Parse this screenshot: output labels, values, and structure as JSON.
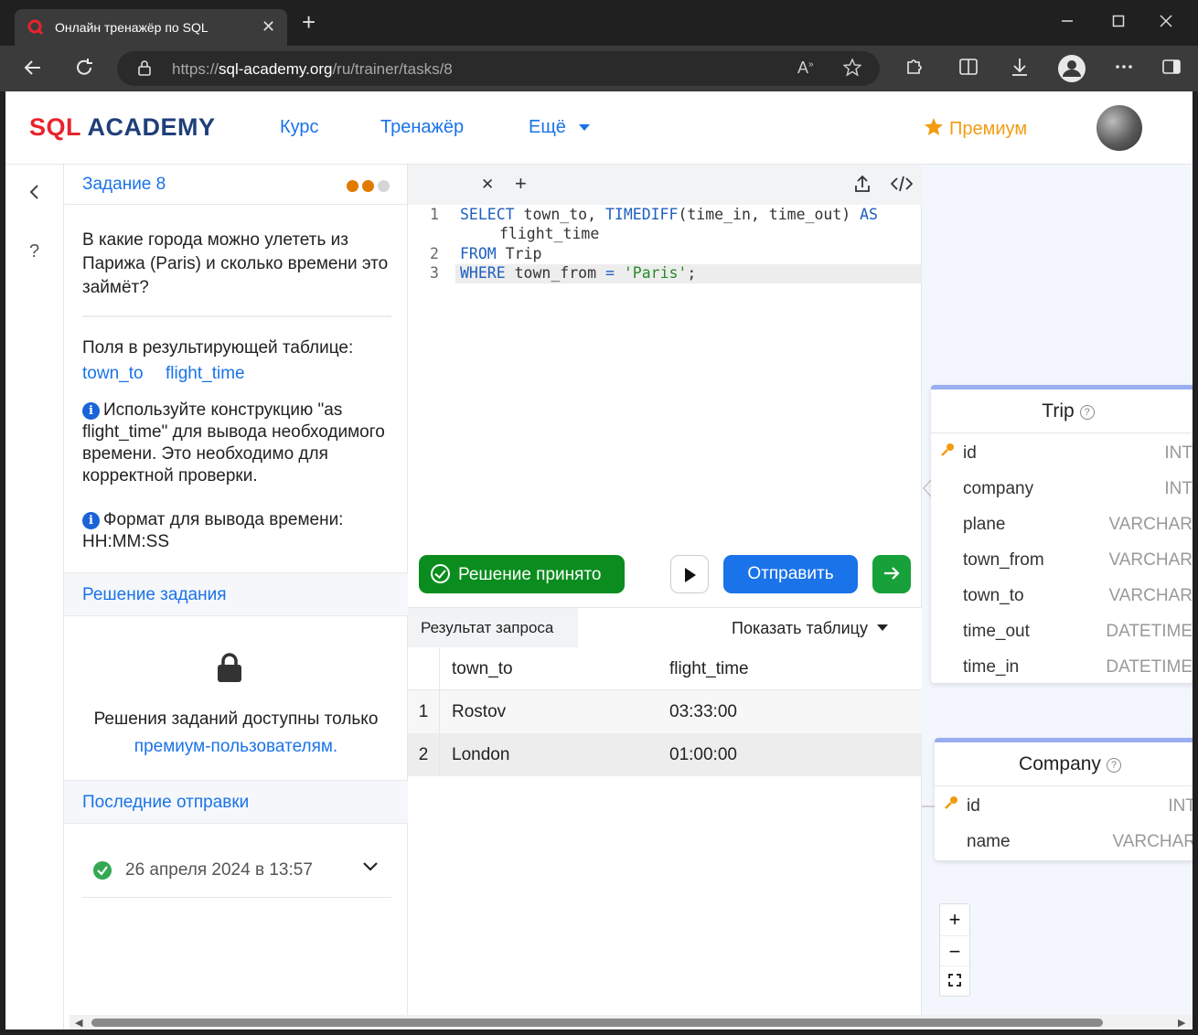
{
  "browser": {
    "tab_title": "Онлайн тренажёр по SQL",
    "tab_close": "✕",
    "new_tab": "+",
    "url_prefix": "https://",
    "url_host": "sql-academy.org",
    "url_path": "/ru/trainer/tasks/8"
  },
  "header": {
    "logo_sql": "SQL",
    "logo_academy": "ACADEMY",
    "nav": [
      "Курс",
      "Тренажёр",
      "Ещё"
    ],
    "premium": "Премиум"
  },
  "rail": {
    "back_icon": "chevron-left-icon",
    "help": "?"
  },
  "task": {
    "title": "Задание 8",
    "dots": [
      "#e07b00",
      "#e07b00",
      "#d0d0d0"
    ],
    "question": "В какие города можно улететь из Парижа (Paris) и сколько времени это займёт?",
    "fields_label": "Поля в результирующей таблице:",
    "fields": [
      "town_to",
      "flight_time"
    ],
    "hint1": "Используйте конструкцию \"as flight_time\" для вывода необходимого времени. Это необходимо для корректной проверки.",
    "hint2": "Формат для вывода времени: HH:MM:SS",
    "solution_header": "Решение задания",
    "locked_text": "Решения заданий доступны только",
    "locked_link": "премиум-пользователям.",
    "submissions_header": "Последние отправки",
    "submission_date": "26 апреля 2024 в 13:57"
  },
  "editor": {
    "lines": [
      {
        "no": "1",
        "code": "SELECT town_to, TIMEDIFF(time_in, time_out) AS"
      },
      {
        "no": "",
        "code": "flight_time"
      },
      {
        "no": "2",
        "code": "FROM Trip"
      },
      {
        "no": "3",
        "code": "WHERE town_from = 'Paris';"
      }
    ],
    "accepted_label": "Решение принято",
    "send_label": "Отправить",
    "result_tab": "Результат запроса",
    "show_table": "Показать таблицу"
  },
  "result": {
    "columns": [
      "town_to",
      "flight_time"
    ],
    "rows": [
      {
        "n": "1",
        "town_to": "Rostov",
        "flight_time": "03:33:00"
      },
      {
        "n": "2",
        "town_to": "London",
        "flight_time": "01:00:00"
      }
    ]
  },
  "schema": {
    "tables": [
      {
        "name": "Trip",
        "columns": [
          {
            "name": "id",
            "type": "INT",
            "key": true
          },
          {
            "name": "company",
            "type": "INT"
          },
          {
            "name": "plane",
            "type": "VARCHAR"
          },
          {
            "name": "town_from",
            "type": "VARCHAR"
          },
          {
            "name": "town_to",
            "type": "VARCHAR"
          },
          {
            "name": "time_out",
            "type": "DATETIME"
          },
          {
            "name": "time_in",
            "type": "DATETIME"
          }
        ]
      },
      {
        "name": "Company",
        "columns": [
          {
            "name": "id",
            "type": "INT",
            "key": true
          },
          {
            "name": "name",
            "type": "VARCHAR"
          }
        ]
      }
    ],
    "zoom": [
      "+",
      "−",
      "⛶"
    ]
  }
}
